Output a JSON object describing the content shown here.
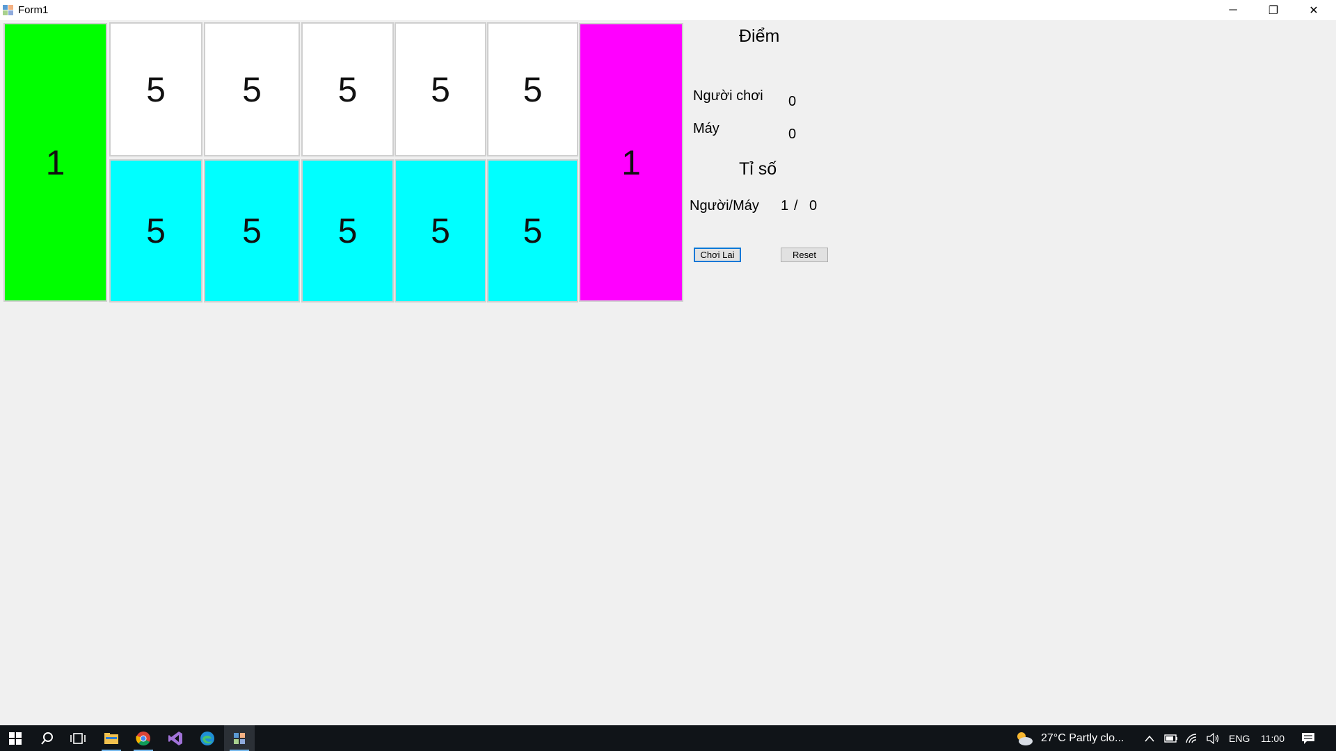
{
  "window": {
    "title": "Form1",
    "minimize_glyph": "─",
    "restore_glyph": "❐",
    "close_glyph": "✕"
  },
  "board": {
    "left_store": "1",
    "right_store": "1",
    "top_row": [
      "5",
      "5",
      "5",
      "5",
      "5"
    ],
    "bottom_row": [
      "5",
      "5",
      "5",
      "5",
      "5"
    ],
    "colors": {
      "left_store": "#00ff00",
      "right_store": "#ff00ff",
      "top_pits": "#ffffff",
      "bottom_pits": "#00ffff"
    }
  },
  "panel": {
    "score_heading": "Điểm",
    "player_label": "Người chơi",
    "player_score": "0",
    "computer_label": "Máy",
    "computer_score": "0",
    "ratio_heading": "Tỉ số",
    "ratio_label": "Người/Máy",
    "ratio_player": "1",
    "ratio_separator": "/",
    "ratio_computer": "0",
    "replay_button": "Chơi Lai",
    "reset_button": "Reset"
  },
  "taskbar": {
    "icons": [
      "windows-start-icon",
      "search-icon",
      "task-view-icon",
      "file-explorer-icon",
      "chrome-icon",
      "visual-studio-icon",
      "edge-icon",
      "form-app-icon"
    ],
    "weather": "27°C  Partly clo...",
    "language": "ENG",
    "time": "11:00"
  }
}
